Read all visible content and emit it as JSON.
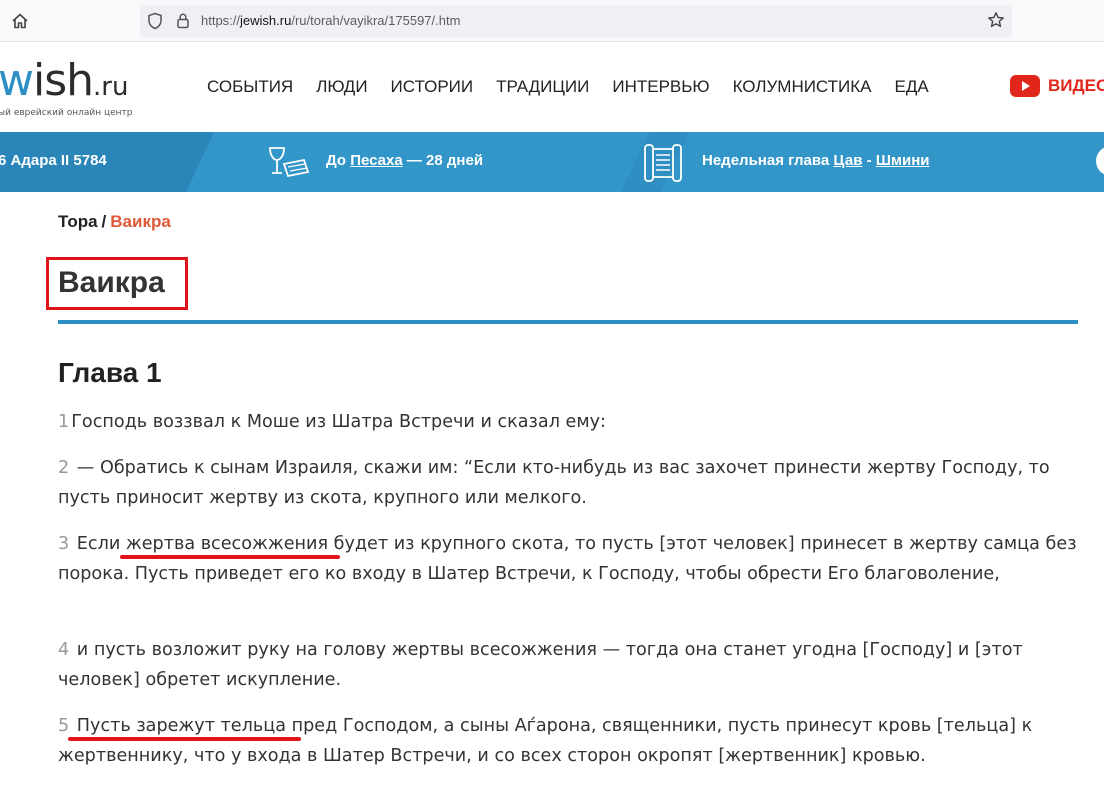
{
  "browser": {
    "url_prefix": "https://",
    "url_domain": "jewish.ru",
    "url_path": "/ru/torah/vayikra/175597/.htm"
  },
  "header": {
    "logo_w": "w",
    "logo_text": "ish",
    "logo_ru": ".ru",
    "logo_tagline": "ый еврейский онлайн центр",
    "nav": [
      "СОБЫТИЯ",
      "ЛЮДИ",
      "ИСТОРИИ",
      "ТРАДИЦИИ",
      "ИНТЕРВЬЮ",
      "КОЛУМНИСТИКА",
      "ЕДА"
    ],
    "video_label": "ВИДЕО"
  },
  "strip": {
    "date": "6 Адара II 5784",
    "holiday_prefix": "До",
    "holiday_name": "Песаха",
    "holiday_suffix": "— 28 дней",
    "parasha_prefix": "Недельная глава",
    "parasha_1": "Цав",
    "parasha_sep": "-",
    "parasha_2": "Шмини"
  },
  "breadcrumb": {
    "root": "Тора",
    "separator": "/",
    "current": "Ваикра"
  },
  "page_title": "Ваикра",
  "chapter": "Глава 1",
  "verses": [
    {
      "num": "1",
      "text": "Господь воззвал к Моше из Шатра Встречи и сказал ему:"
    },
    {
      "num": "2",
      "text": "— Обратись к сынам Израиля, скажи им: “Если кто-нибудь из вас захочет принести жертву Господу, то пусть приносит жертву из скота, крупного или мелкого."
    },
    {
      "num": "3",
      "text": "Если жертва всесожжения будет из крупного скота, то пусть [этот человек] принесет в жертву самца без порока. Пусть приведет его ко входу в Шатер Встречи, к Господу, чтобы обрести Его благоволение,"
    },
    {
      "num": "4",
      "text": "и пусть возложит руку на голову жертвы всесожжения — тогда она станет угодна [Господу] и [этот человек] обретет искупление."
    },
    {
      "num": "5",
      "text": "Пусть зарежут тельца пред Господом, а сыны Аѓарона, священники, пусть принесут кровь [тельца] к жертвеннику, что у входа в Шатер Встречи, и со всех сторон окропят [жертвенник] кровью."
    }
  ],
  "colors": {
    "accent_blue": "#3396c9",
    "breadcrumb_current": "#e05a3a",
    "annotation_red": "#e0131a"
  }
}
